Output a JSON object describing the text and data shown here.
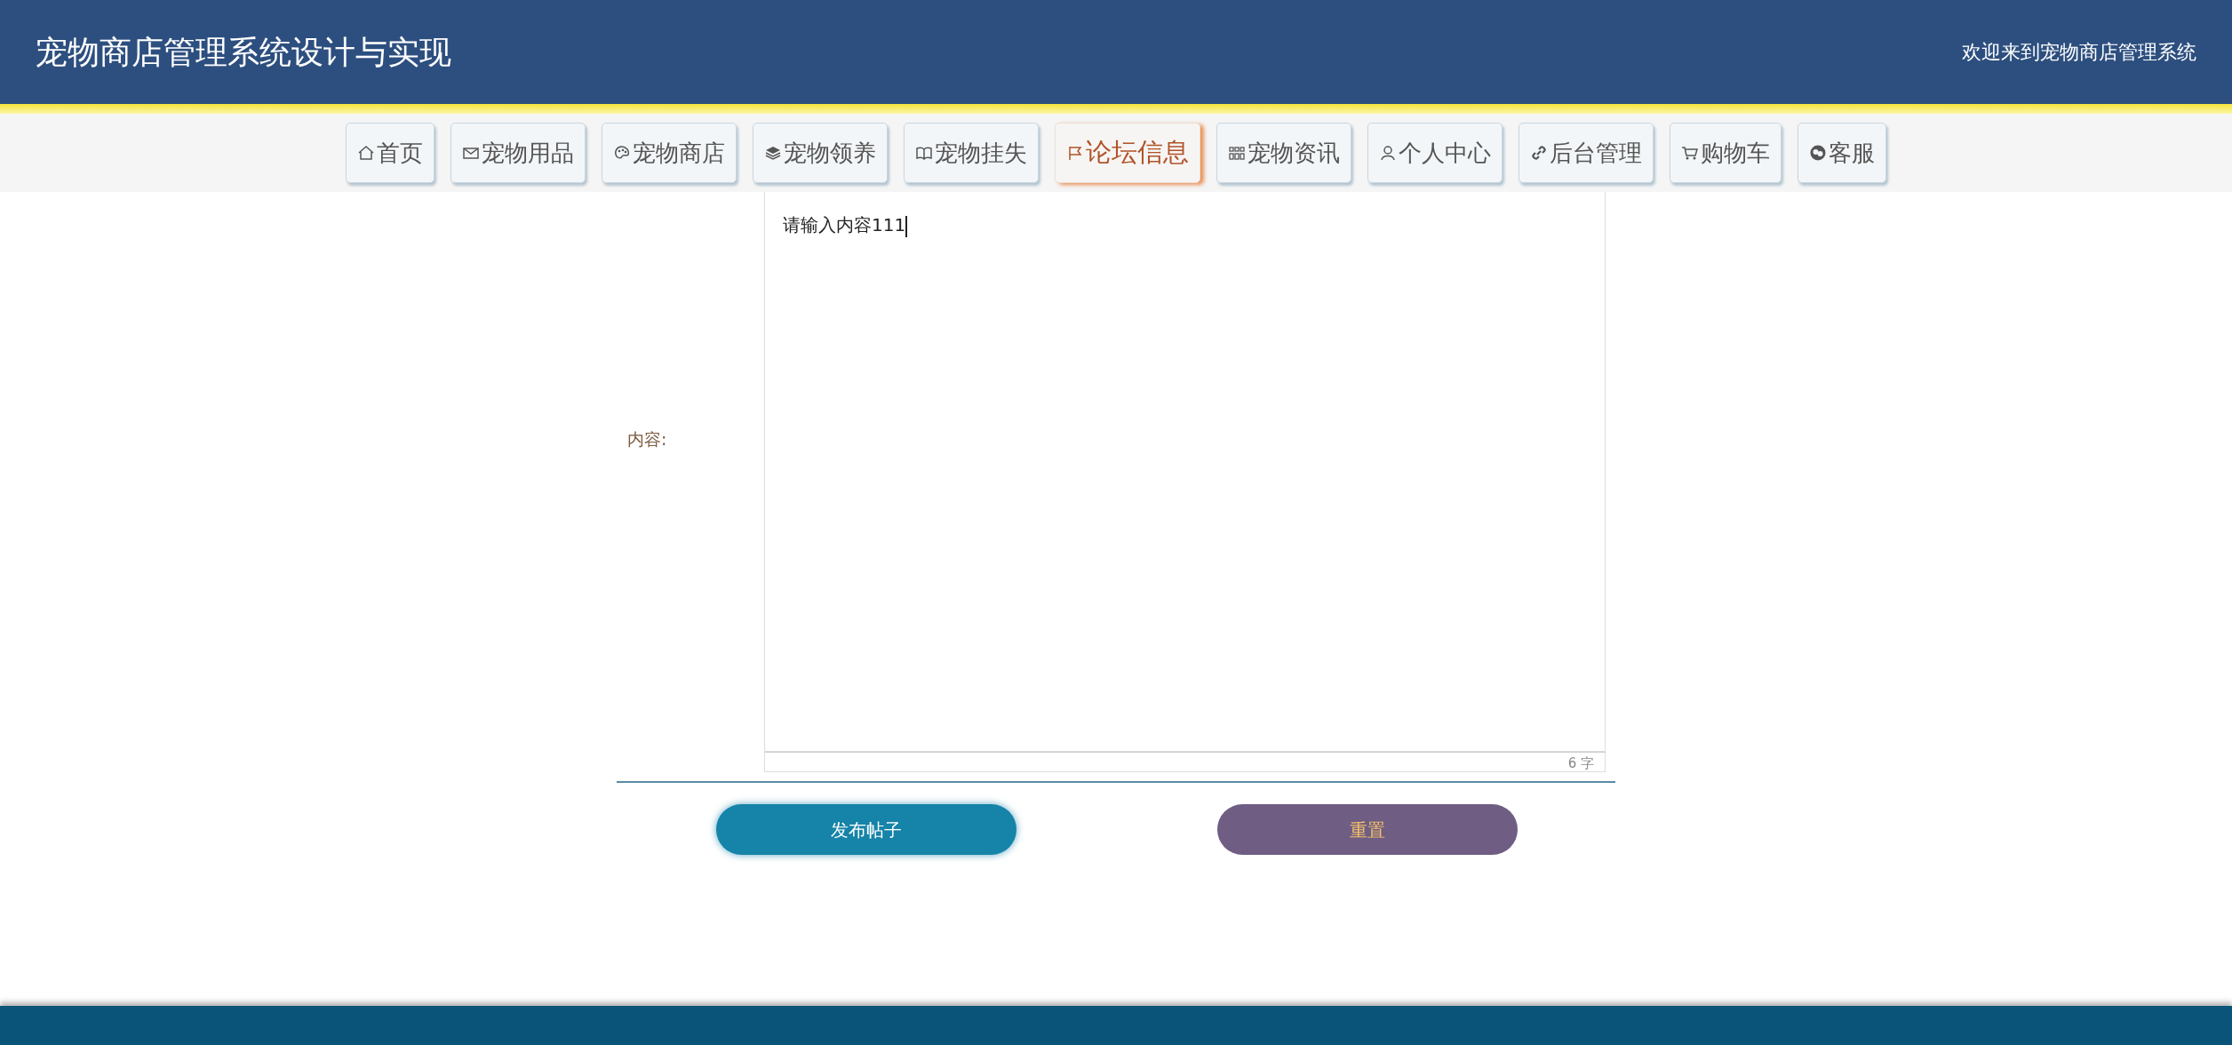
{
  "header": {
    "title": "宠物商店管理系统设计与实现",
    "welcome": "欢迎来到宠物商店管理系统"
  },
  "nav": [
    {
      "label": "首页",
      "selected": false
    },
    {
      "label": "宠物用品",
      "selected": false
    },
    {
      "label": "宠物商店",
      "selected": false
    },
    {
      "label": "宠物领养",
      "selected": false
    },
    {
      "label": "宠物挂失",
      "selected": false
    },
    {
      "label": "论坛信息",
      "selected": true
    },
    {
      "label": "宠物资讯",
      "selected": false
    },
    {
      "label": "个人中心",
      "selected": false
    },
    {
      "label": "后台管理",
      "selected": false
    },
    {
      "label": "购物车",
      "selected": false
    },
    {
      "label": "客服",
      "selected": false
    }
  ],
  "form": {
    "content_label": "内容:",
    "content_value": "请输入内容111",
    "word_count": "6 字"
  },
  "buttons": [
    {
      "kind": "submit",
      "label": "发布帖子"
    },
    {
      "kind": "reset",
      "label": "重置"
    }
  ]
}
